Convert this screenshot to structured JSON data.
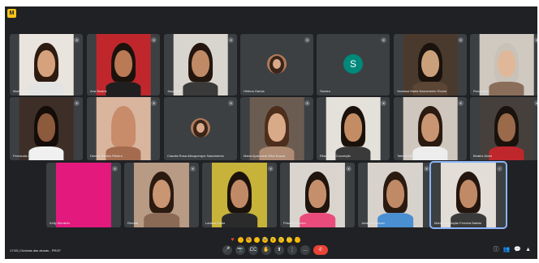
{
  "app": {
    "badge": "M"
  },
  "participants": [
    {
      "name": "Maria Eduarda Souza",
      "bg": "#e9e4dd",
      "skin": "#d6a27d",
      "hair": "#2d1a10",
      "shirt": "#e3e3e3",
      "mic": "✕"
    },
    {
      "name": "Ana Beatriz",
      "bg": "#c0272d",
      "skin": "#b97a55",
      "hair": "#1c120c",
      "shirt": "#1f1f1f",
      "mic": "✕"
    },
    {
      "name": "Jaqueline",
      "bg": "#d8d5cf",
      "skin": "#c08a66",
      "hair": "#24160f",
      "shirt": "#3a3a3a",
      "mic": "✕"
    },
    {
      "name": "Helena Garcia",
      "avatar_photo": true,
      "mic": "✕"
    },
    {
      "name": "Sandra",
      "avatar": "S",
      "mic": "✕"
    },
    {
      "name": "Vanessa Maria Nascimento Rocha",
      "bg": "#4a3a2e",
      "skin": "#caa07c",
      "hair": "#1a120d",
      "shirt": "#5b4636",
      "mic": "✕"
    },
    {
      "name": "Rosangela",
      "bg": "#cfc9c0",
      "skin": "#e0b899",
      "hair": "#c9c2b8",
      "shirt": "#8a6e5a",
      "mic": "✕"
    },
    {
      "name": "Fernanda Lima",
      "bg": "#3d2f28",
      "skin": "#8c5a3c",
      "hair": "#140c08",
      "shirt": "#f0f0f0",
      "mic": "✕"
    },
    {
      "name": "Denise Santos Ribeiro",
      "bg": "#d9b59e",
      "skin": "#c88c6a",
      "hair": "#c88c6a",
      "shirt": "#a46b4e",
      "mic": "✕"
    },
    {
      "name": "Claudia Rosa Albuquerque Nascimento",
      "avatar_photo": true,
      "mic": "✕"
    },
    {
      "name": "Maria Aparecida Silva Souza",
      "bg": "#6b5c52",
      "skin": "#d9aa88",
      "hair": "#4d2e1d",
      "shirt": "#b08c74",
      "mic": "✕"
    },
    {
      "name": "Elisangela Conceição",
      "bg": "#e4e0da",
      "skin": "#c48c64",
      "hair": "#1b110b",
      "shirt": "#3a3a3a",
      "mic": "✕"
    },
    {
      "name": "Tatiane Oliveira",
      "bg": "#cfc7bd",
      "skin": "#c99572",
      "hair": "#2a1a10",
      "shirt": "#ededed",
      "mic": "✕"
    },
    {
      "name": "Beatriz Alves",
      "bg": "#45403c",
      "skin": "#9a6a4a",
      "hair": "#1a120d",
      "shirt": "#c0272d",
      "mic": "✕"
    },
    {
      "name": "Kelly Monteiro",
      "bg": "#e3197d",
      "skin": "#e3197d",
      "hair": "#e3197d",
      "shirt": "#e3197d",
      "mic": "✕"
    },
    {
      "name": "Renata",
      "bg": "#b89b85",
      "skin": "#c99572",
      "hair": "#2b1a10",
      "shirt": "#8a6a55",
      "mic": "✕"
    },
    {
      "name": "Larissa Costa",
      "bg": "#c7b23a",
      "skin": "#c08a66",
      "hair": "#1c120c",
      "shirt": "#2b2b2b",
      "mic": "✕"
    },
    {
      "name": "Priscila Moreira",
      "bg": "#d9d4ce",
      "skin": "#c58f6c",
      "hair": "#1f140e",
      "shirt": "#e94b7a",
      "mic": "✕"
    },
    {
      "name": "Juliana Cardoso",
      "bg": "#d7d2cb",
      "skin": "#c08a66",
      "hair": "#2a1a10",
      "shirt": "#4a8fd1",
      "mic": "✕"
    },
    {
      "name": "Maria Conceição Ferreira Batista",
      "bg": "#e2ddd6",
      "skin": "#c08a66",
      "hair": "#24160f",
      "shirt": "#3a3a3a",
      "mic": "✓",
      "active": true
    }
  ],
  "reactions": [
    "♥",
    "👍",
    "🎉",
    "👏",
    "😂",
    "😮",
    "😢",
    "🤔",
    "👎"
  ],
  "bottom_bar": {
    "meeting_info": "17:53  |  Dúvidas das alunas - PROF",
    "controls": [
      "🎤",
      "📷",
      "CC",
      "✋",
      "⬆",
      "⋮",
      "…"
    ],
    "leave_icon": "✆",
    "right_tools": [
      "ⓘ",
      "👥",
      "💬",
      "▲"
    ]
  }
}
